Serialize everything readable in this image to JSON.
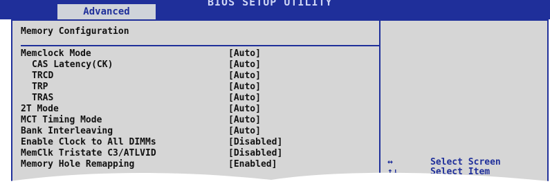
{
  "header": {
    "title": "BIOS SETUP UTILITY",
    "tab_label": "Advanced"
  },
  "section_title": "Memory Configuration",
  "settings": [
    {
      "label": "Memclock Mode",
      "value": "[Auto]",
      "indent": false
    },
    {
      "label": "CAS Latency(CK)",
      "value": "[Auto]",
      "indent": true
    },
    {
      "label": "TRCD",
      "value": "[Auto]",
      "indent": true
    },
    {
      "label": "TRP",
      "value": "[Auto]",
      "indent": true
    },
    {
      "label": "TRAS",
      "value": "[Auto]",
      "indent": true
    },
    {
      "label": "2T Mode",
      "value": "[Auto]",
      "indent": false
    },
    {
      "label": "MCT Timing Mode",
      "value": "[Auto]",
      "indent": false
    },
    {
      "label": "Bank Interleaving",
      "value": "[Auto]",
      "indent": false
    },
    {
      "label": "Enable Clock to All DIMMs",
      "value": "[Disabled]",
      "indent": false
    },
    {
      "label": "MemClk Tristate C3/ATLVID",
      "value": "[Disabled]",
      "indent": false
    },
    {
      "label": "Memory Hole Remapping",
      "value": "[Enabled]",
      "indent": false
    }
  ],
  "help": [
    {
      "key": "↔",
      "text": "Select Screen"
    },
    {
      "key": "↑↓",
      "text": "Select Item"
    }
  ],
  "colors": {
    "bios_blue": "#1f2f9a",
    "panel_gray": "#d6d6d6",
    "tab_bg": "#cfd3da"
  }
}
